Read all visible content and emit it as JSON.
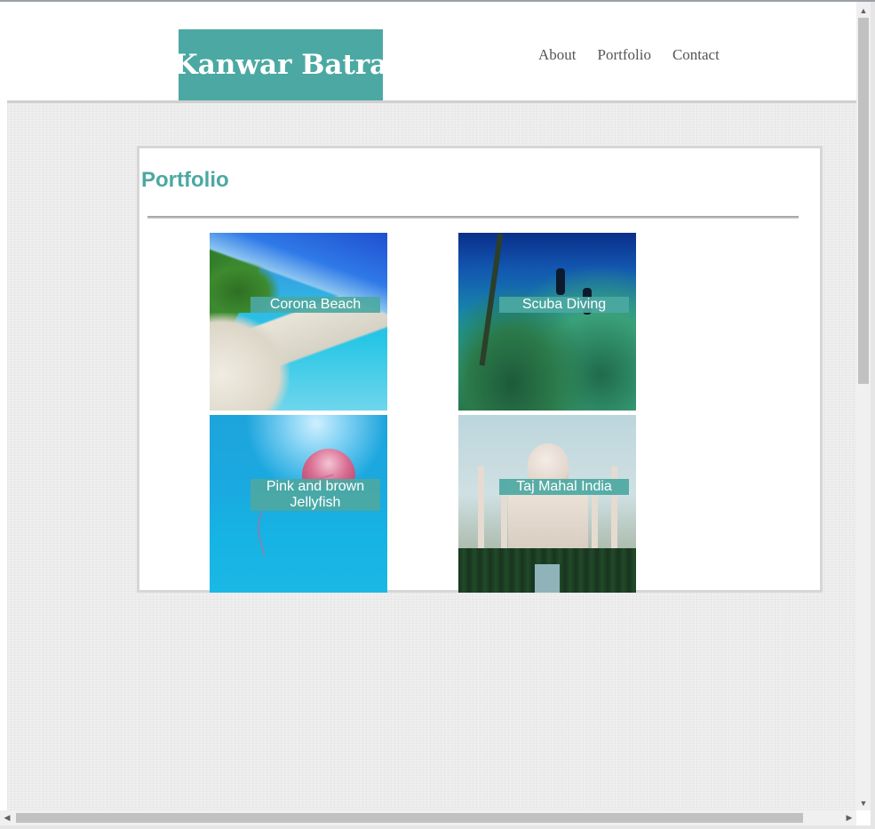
{
  "header": {
    "logo_text": "Kanwar Batra",
    "nav": [
      {
        "label": "About"
      },
      {
        "label": "Portfolio"
      },
      {
        "label": "Contact"
      }
    ]
  },
  "main": {
    "title": "Portfolio",
    "items": [
      {
        "caption": "Corona Beach",
        "image": "beach-photo"
      },
      {
        "caption": "Scuba Diving",
        "image": "scuba-photo"
      },
      {
        "caption": "Pink and brown Jellyfish",
        "image": "jellyfish-photo"
      },
      {
        "caption": "Taj Mahal India",
        "image": "taj-mahal-photo"
      }
    ]
  },
  "colors": {
    "accent": "#4ca8a2",
    "page_background": "#efefef",
    "card_border": "#d6d6d6",
    "nav_text": "#555555"
  }
}
